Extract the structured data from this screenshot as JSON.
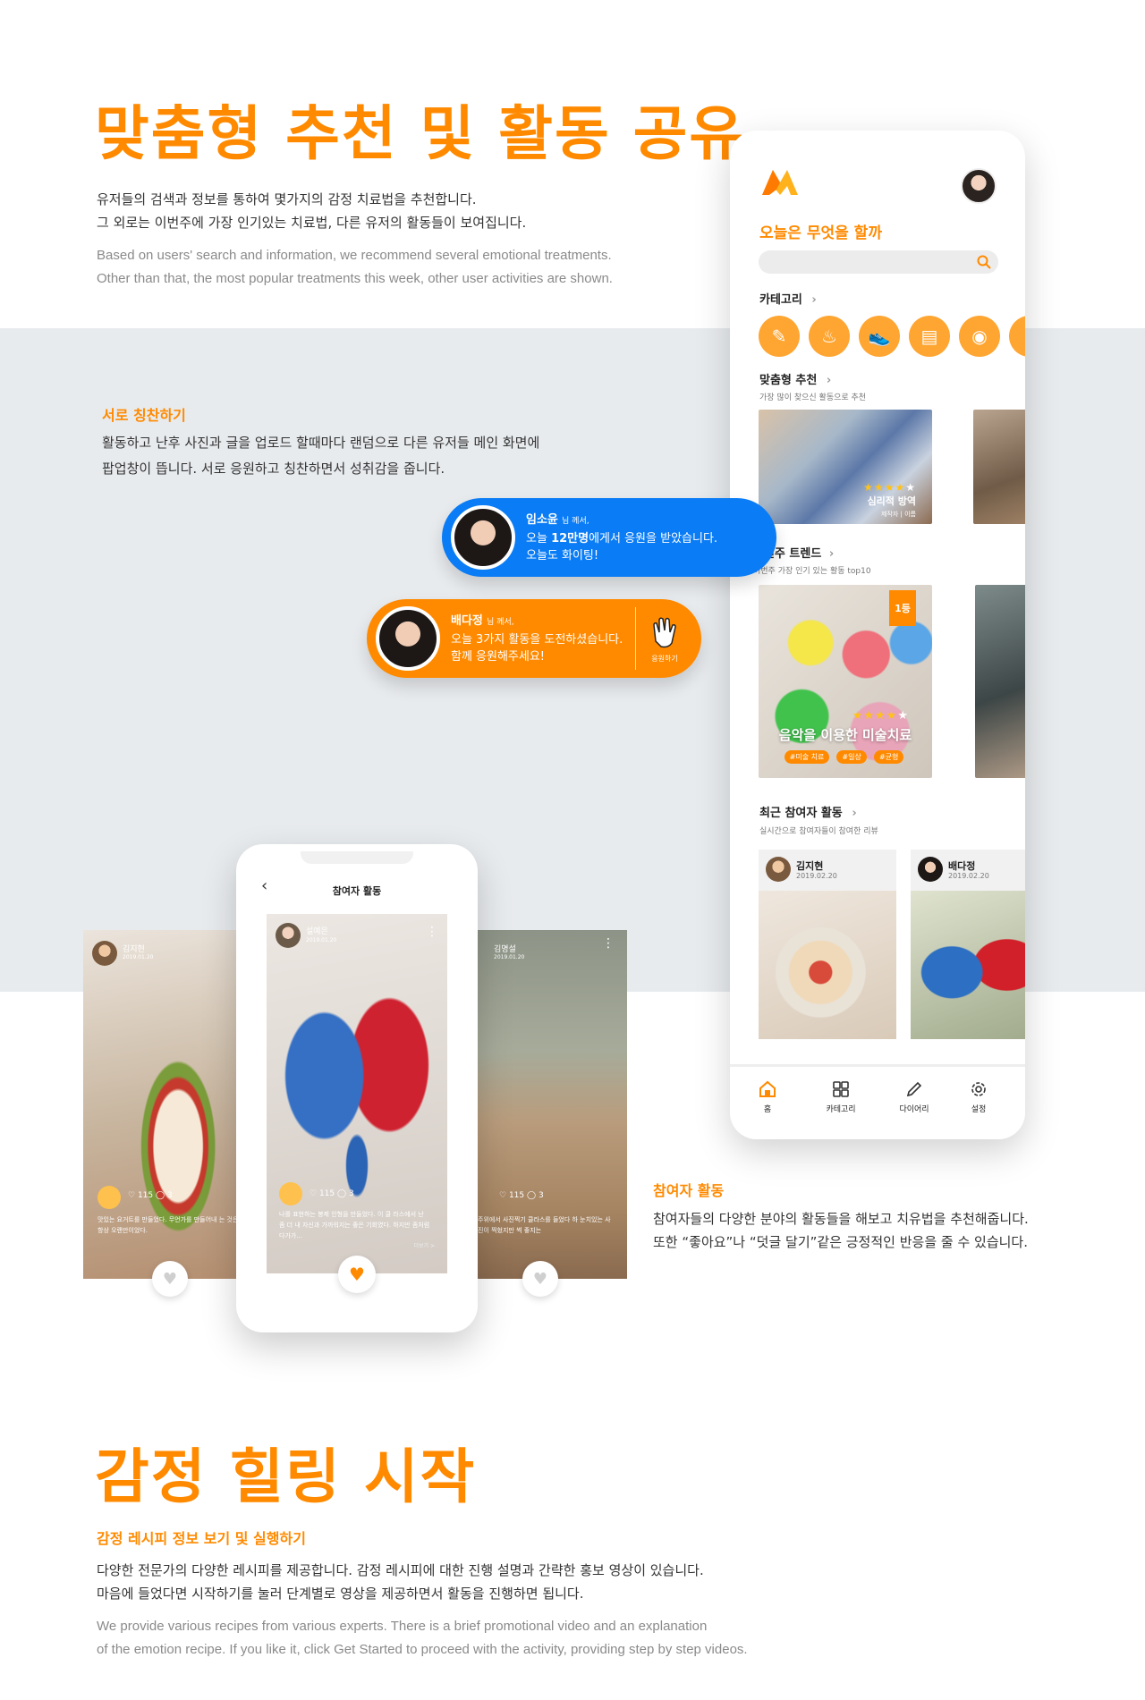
{
  "section1": {
    "title": "맞춤형 추천 및 활동 공유",
    "ko_lines": [
      "유저들의 검색과 정보를 통하여 몇가지의 감정 치료법을 추천합니다.",
      "그 외로는 이번주에 가장 인기있는 치료법, 다른 유저의 활동들이 보여집니다."
    ],
    "en_lines": [
      "Based on users' search and information, we recommend several emotional treatments.",
      "Other than that, the most popular treatments this week, other user activities are shown."
    ]
  },
  "praise": {
    "title": "서로 칭찬하기",
    "lines": [
      "활동하고 난후 사진과 글을 업로드 할때마다 랜덤으로 다른 유저들 메인 화면에",
      "팝업창이 뜹니다. 서로 응원하고 칭찬하면서 성취감을 줍니다."
    ]
  },
  "popup_blue": {
    "name": "임소윤",
    "suffix": "님 께서,",
    "line1_pre": "오늘 ",
    "line1_bold": "12만명",
    "line1_post": "에게서 응원을 받았습니다.",
    "line2": "오늘도 화이팅!",
    "color": "#0a7cf5"
  },
  "popup_orange": {
    "name": "배다정",
    "suffix": "님 께서,",
    "line1": "오늘 3가지 활동을 도전하셨습니다.",
    "line2": "함께 응원해주세요!",
    "cheer_label": "응원하기",
    "color": "#ff8a00"
  },
  "app": {
    "greeting": "오늘은 무엇을 할까",
    "search_placeholder": "",
    "category_title": "카테고리",
    "category_icons": [
      "palette-icon",
      "chef-hat-icon",
      "running-shoe-icon",
      "book-icon",
      "radio-icon",
      "music-note-icon"
    ],
    "rec_title": "맞춤형 추천",
    "rec_sub": "가장 많이 찾으신 활동으로 추천",
    "rec_card": {
      "title": "심리적 방역",
      "author": "제작자 | 이름",
      "stars": 4
    },
    "trend_title": "이번주 트렌드",
    "trend_sub": "이번주 가장 인기 있는 활동 top10",
    "trend_badge": "1등",
    "trend_card": {
      "title": "음악을 이용한 미술치료",
      "tags": [
        "#미술 치료",
        "#일상",
        "#균형"
      ],
      "stars": 4
    },
    "recent_title": "최근 참여자 활동",
    "recent_sub": "실시간으로 참여자들이 참여한 리뷰",
    "recent_cards": [
      {
        "name": "김지현",
        "date": "2019.02.20"
      },
      {
        "name": "배다정",
        "date": "2019.02.20"
      }
    ],
    "nav": [
      {
        "label": "홈",
        "icon": "home-icon"
      },
      {
        "label": "카테고리",
        "icon": "grid-icon"
      },
      {
        "label": "다이어리",
        "icon": "pencil-icon"
      },
      {
        "label": "설정",
        "icon": "settings-icon"
      }
    ]
  },
  "participant_screen": {
    "title": "참여자 활동",
    "center_card": {
      "name": "설예은",
      "date": "2019.01.20",
      "likes": "115",
      "comments": "3",
      "text": "나를 표현하는 봉제 인형을 만들었다. 이 클 라스에서 난 좀 더 내 자신과 가까워지는 좋은 기회였다. 하지만 좀처럼 다가가...",
      "more": "더보기 >"
    },
    "left_card": {
      "name": "김지현",
      "date": "2019.01.20",
      "likes": "115",
      "comments": "3",
      "text": "맛있는 요거트를 만들었다. 무언가를 만들어내 는 것은 항상 오랜만이었다."
    },
    "right_card": {
      "name": "김명설",
      "date": "2019.01.20",
      "likes": "115",
      "comments": "3",
      "text": "주위에서 사진찍기 클라스를 들었다 하 눈치있는 사진이 찍혔지만 썩 좋지는"
    }
  },
  "participant": {
    "title": "참여자 활동",
    "lines": [
      "참여자들의 다양한 분야의 활동들을 해보고 치유법을 추천해줍니다.",
      "또한 “좋아요”나 “덧글 달기”같은 긍정적인 반응을 줄 수 있습니다."
    ]
  },
  "section2": {
    "title": "감정 힐링 시작",
    "subtitle": "감정 레시피 정보 보기 및 실행하기",
    "ko_lines": [
      "다양한 전문가의 다양한 레시피를 제공합니다. 감정 레시피에 대한 진행 설명과 간략한 홍보 영상이 있습니다.",
      "마음에 들었다면 시작하기를 눌러 단계별로 영상을 제공하면서 활동을 진행하면 됩니다."
    ],
    "en_lines": [
      "We provide various recipes from various experts. There is a brief promotional video and an explanation",
      "of the emotion recipe. If you like it, click Get Started to proceed with the activity, providing step by step videos."
    ]
  }
}
